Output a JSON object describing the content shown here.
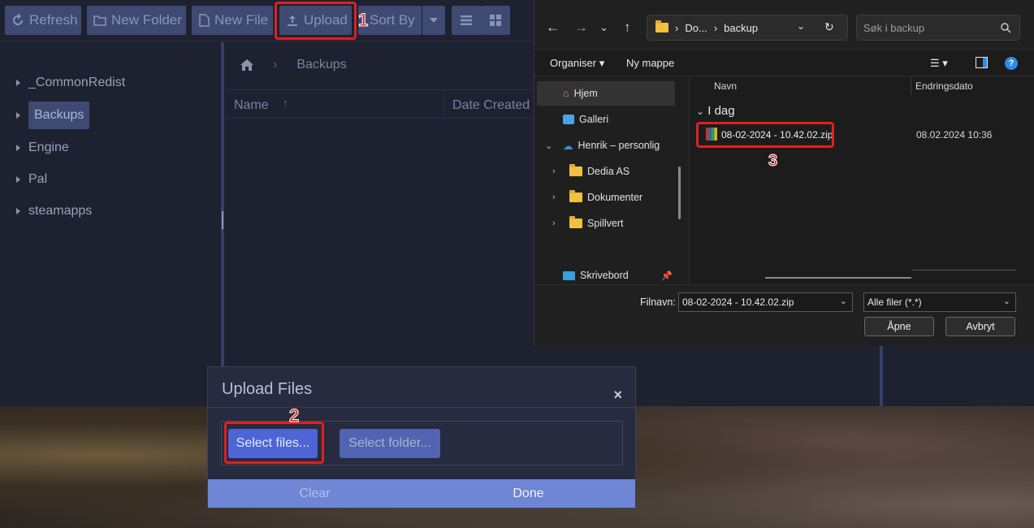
{
  "toolbar": {
    "refresh": "Refresh",
    "new_folder": "New Folder",
    "new_file": "New File",
    "upload": "Upload",
    "sort_by": "Sort By"
  },
  "annotations": {
    "step1": "1",
    "step2": "2",
    "step3": "3"
  },
  "tree": {
    "items": [
      {
        "label": "_CommonRedist"
      },
      {
        "label": "Backups"
      },
      {
        "label": "Engine"
      },
      {
        "label": "Pal"
      },
      {
        "label": "steamapps"
      }
    ]
  },
  "breadcrumb": {
    "current": "Backups"
  },
  "file_list": {
    "col_name": "Name",
    "col_date": "Date Created",
    "sort_indicator": "↑"
  },
  "upload_modal": {
    "title": "Upload Files",
    "close": "×",
    "select_files": "Select files...",
    "select_folder": "Select folder...",
    "clear": "Clear",
    "done": "Done"
  },
  "file_dialog": {
    "address": {
      "part1": "Do...",
      "part2": "backup"
    },
    "search_placeholder": "Søk i backup",
    "organise": "Organiser ▾",
    "new_folder": "Ny mappe",
    "help": "?",
    "nav": [
      {
        "label": "Hjem"
      },
      {
        "label": "Galleri"
      },
      {
        "label": "Henrik – personlig"
      },
      {
        "label": "Dedia AS"
      },
      {
        "label": "Dokumenter"
      },
      {
        "label": "Spillvert"
      },
      {
        "label": "Skrivebord"
      }
    ],
    "col_name": "Navn",
    "col_modified": "Endringsdato",
    "group": "I dag",
    "file": {
      "name": "08-02-2024 - 10.42.02.zip",
      "modified": "08.02.2024 10:36"
    },
    "filename_label": "Filnavn:",
    "filename_value": "08-02-2024 - 10.42.02.zip",
    "filetype_value": "Alle filer (*.*)",
    "open": "Åpne",
    "cancel": "Avbryt"
  },
  "colors": {
    "accent": "#4e65d5",
    "highlight": "#e02020",
    "toolbar_button": "#3e4a72"
  }
}
